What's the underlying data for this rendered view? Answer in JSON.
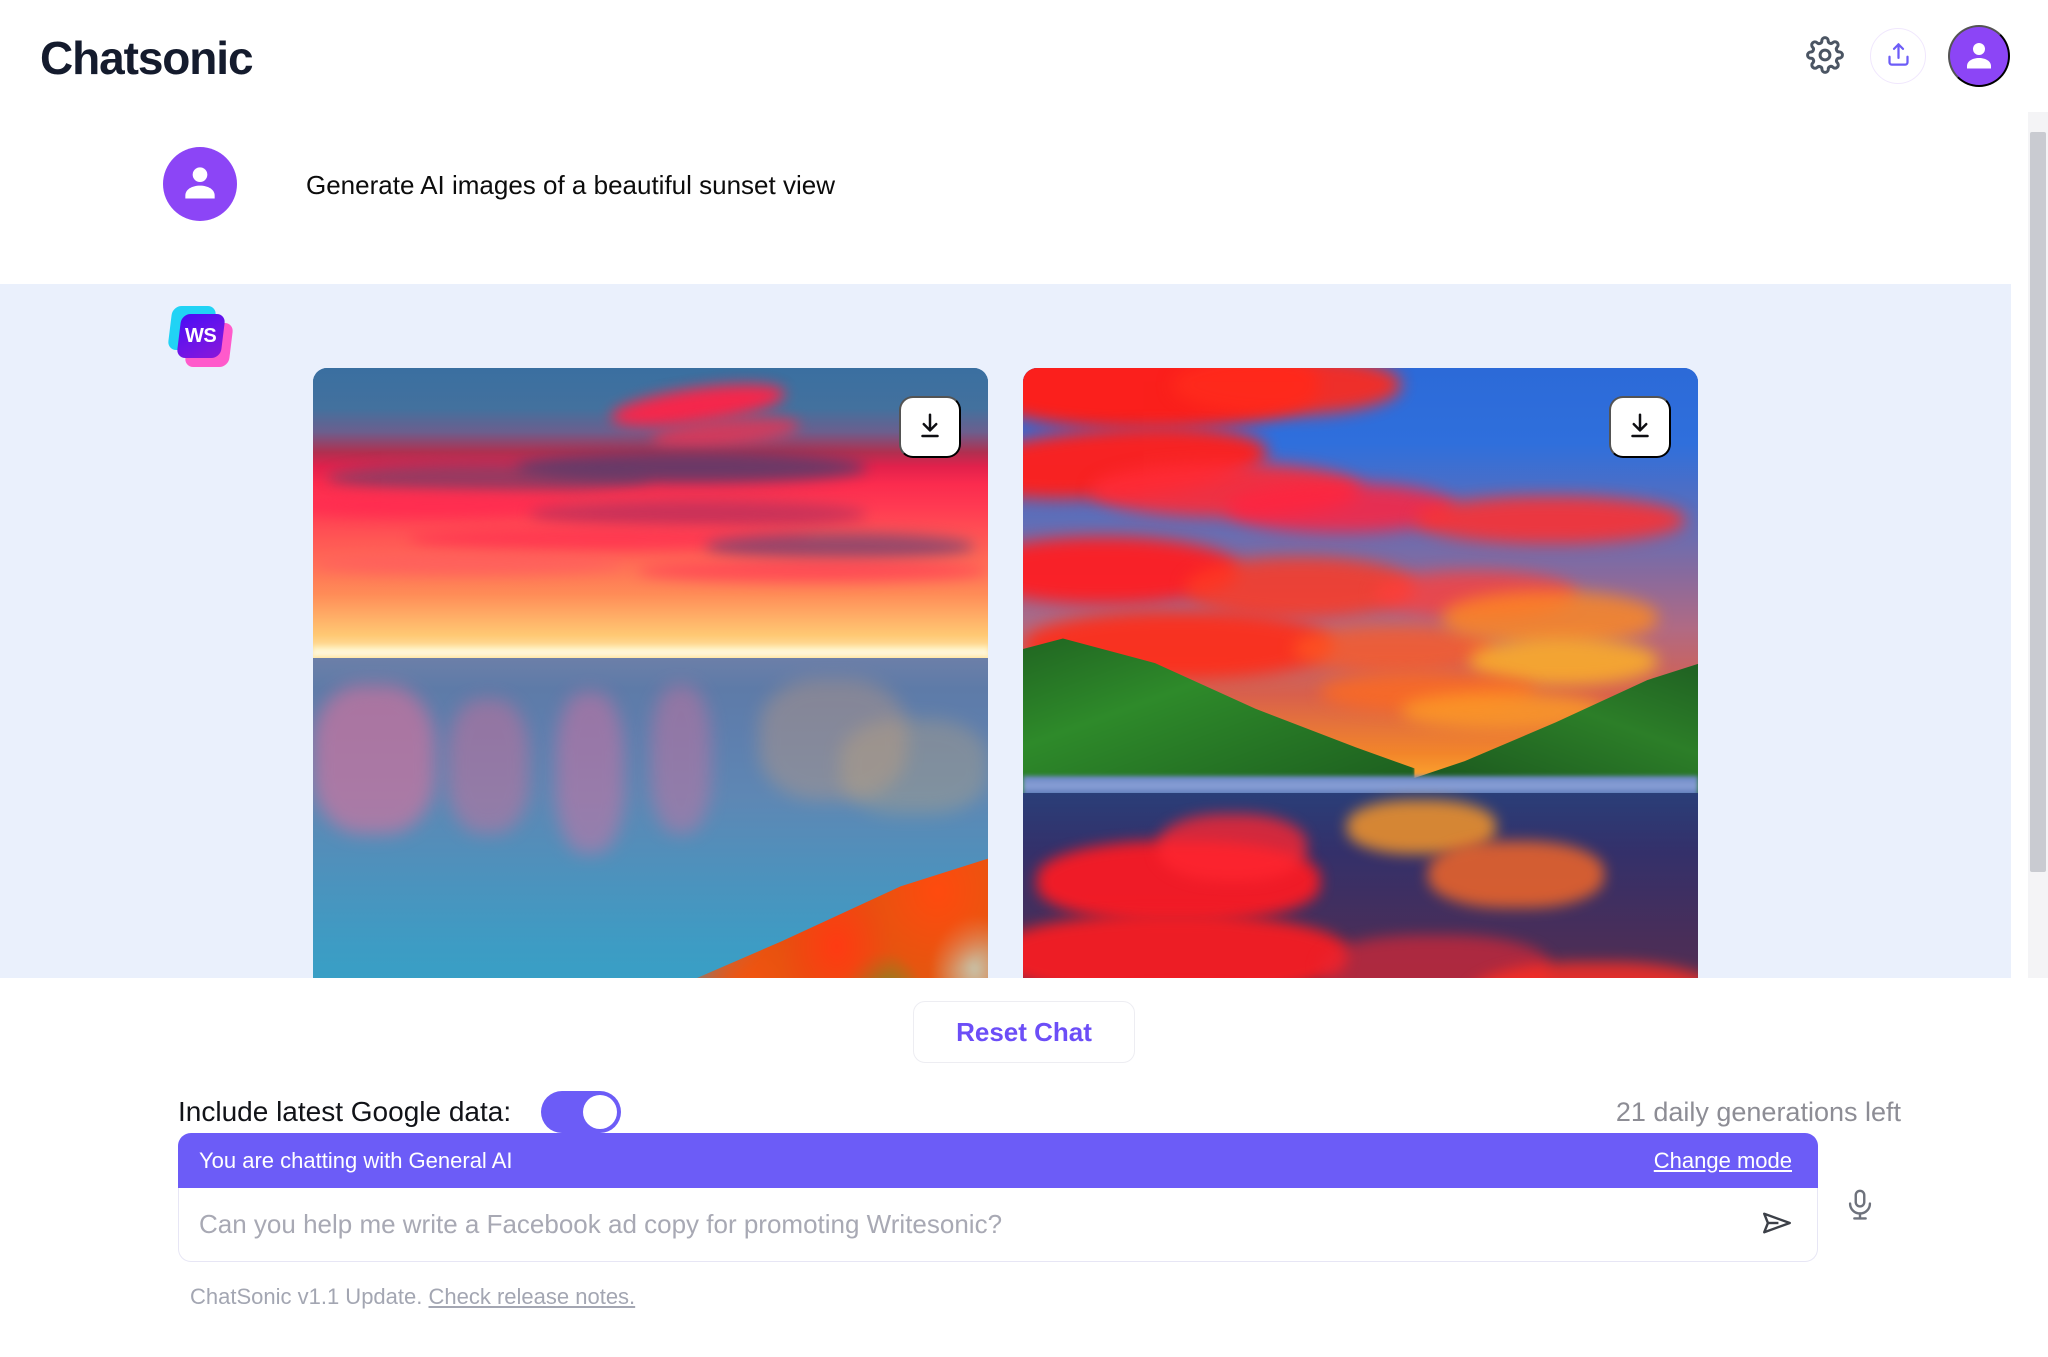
{
  "header": {
    "brand": "Chatsonic",
    "settings_icon": "gear-icon",
    "share_icon": "share-upload-icon",
    "avatar_icon": "user-avatar-icon"
  },
  "conversation": {
    "user_message": {
      "avatar_icon": "user-avatar-icon",
      "text": "Generate AI images of a beautiful sunset view"
    },
    "bot_message": {
      "logo_text": "WS",
      "logo_name": "writesonic-logo",
      "images": [
        {
          "alt": "AI generated coastal sunset over the ocean with red clouds and autumn foliage",
          "download_label": "Download",
          "download_icon": "download-icon"
        },
        {
          "alt": "AI generated lake sunset with vivid red clouds, green hills and reflections",
          "download_label": "Download",
          "download_icon": "download-icon"
        }
      ]
    }
  },
  "controls": {
    "reset_label": "Reset Chat",
    "google_data_label": "Include latest Google data:",
    "google_data_on": true,
    "generations_left": "21 daily generations left"
  },
  "composer": {
    "mode_text": "You are chatting with General AI",
    "change_mode_label": "Change mode",
    "input_value": "",
    "input_placeholder": "Can you help me write a Facebook ad copy for promoting Writesonic?",
    "send_icon": "send-paper-plane-icon",
    "mic_icon": "microphone-icon"
  },
  "footer": {
    "update_text": "ChatSonic v1.1 Update.",
    "release_notes_label": "Check release notes."
  },
  "colors": {
    "accent_purple": "#6C5CF7",
    "avatar_purple": "#8C45F6",
    "bot_bg": "#EAF0FC",
    "brand_dark": "#141B2D",
    "muted_text": "#8D8D95"
  }
}
